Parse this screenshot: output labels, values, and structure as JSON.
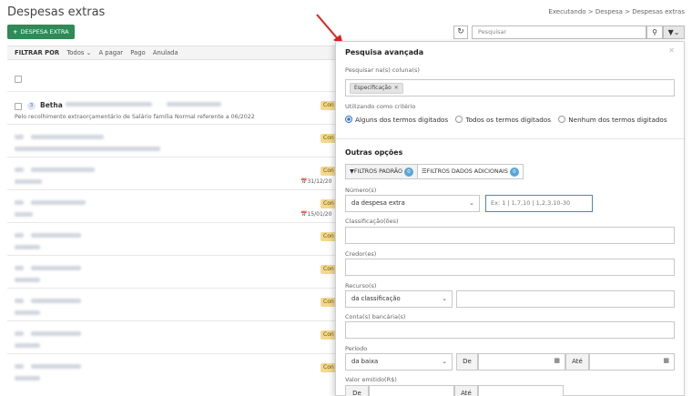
{
  "page": {
    "title": "Despesas extras"
  },
  "breadcrumb": {
    "text": "Executando > Despesa > Despesas extras"
  },
  "toolbar": {
    "add_label": "DESPESA EXTRA",
    "search_placeholder": "Pesquisar"
  },
  "filterbar": {
    "label": "FILTRAR POR",
    "options": [
      "Todos",
      "A pagar",
      "Pago",
      "Anulada"
    ]
  },
  "list": {
    "first": {
      "number": "3",
      "name": "Betha",
      "description": "Pelo recolhimento extraorçamentário de Salário família Normal referente a 06/2022",
      "badge": "Con"
    },
    "badges": [
      "Con",
      "Con",
      "Con",
      "Con",
      "Con",
      "Con",
      "Con",
      "Con",
      "Con"
    ],
    "dates": [
      "31/12/20",
      "15/01/20"
    ]
  },
  "panel": {
    "title": "Pesquisa avançada",
    "search_in_label": "Pesquisar na(s) coluna(s)",
    "tag": "Especificação",
    "criteria_label": "Utilizando como critério",
    "radios": [
      "Alguns dos termos digitados",
      "Todos os termos digitados",
      "Nenhum dos termos digitados"
    ],
    "other_options": "Outras opções",
    "tabs": [
      {
        "label": "FILTROS PADRÃO",
        "count": "0"
      },
      {
        "label": "FILTROS DADOS ADICIONAIS",
        "count": "0"
      }
    ],
    "numero_label": "Número(s)",
    "numero_select": "da despesa extra",
    "numero_placeholder": "Ex: 1 | 1,7,10 | 1,2,3,10-30",
    "classificacao_label": "Classificação(ões)",
    "credor_label": "Credor(es)",
    "recurso_label": "Recurso(s)",
    "recurso_select": "da classificação",
    "conta_label": "Conta(s) bancária(s)",
    "periodo_label": "Período",
    "periodo_select": "da baixa",
    "de": "De",
    "ate": "Até",
    "valor_label": "Valor emitido(R$)"
  }
}
